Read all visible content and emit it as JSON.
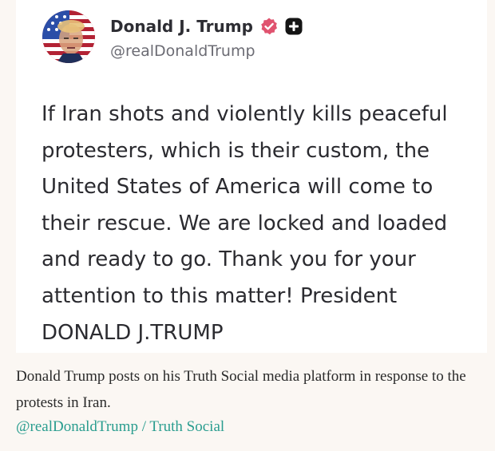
{
  "post": {
    "display_name": "Donald J. Trump",
    "handle": "@realDonaldTrump",
    "text": "If Iran shots and violently kills peaceful\nprotesters, which is their custom, the\nUnited States of America will come to\ntheir rescue. We are locked and loaded\nand ready to go. Thank you for your\nattention to this matter! President\nDONALD J.TRUMP",
    "icons": {
      "avatar": "avatar-american-flag-portrait",
      "verified": "verified-badge-icon",
      "follow": "plus-icon"
    },
    "colors": {
      "verified_badge": "#e0536f",
      "text": "#2b2b30",
      "handle": "#6c6c74"
    }
  },
  "caption": {
    "text": "Donald Trump posts on his Truth Social media platform in response to the protests in Iran.",
    "credit": "@realDonaldTrump / Truth Social",
    "credit_color": "#2a9d8f"
  }
}
